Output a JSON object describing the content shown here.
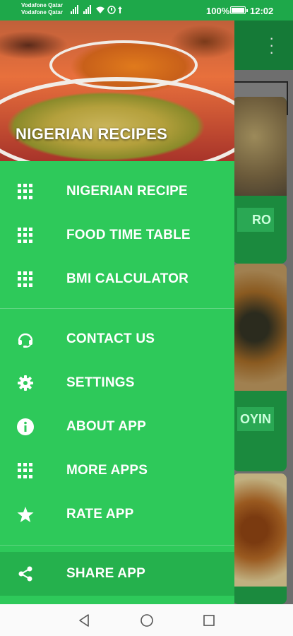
{
  "status_bar": {
    "carrier1": "Vodafone Qatar",
    "carrier2": "Vodafone Qatar",
    "battery": "100%",
    "time": "12:02"
  },
  "drawer": {
    "title": "NIGERIAN RECIPES",
    "primary_items": [
      {
        "label": "NIGERIAN RECIPE",
        "icon": "grid-icon"
      },
      {
        "label": "FOOD TIME TABLE",
        "icon": "grid-icon"
      },
      {
        "label": "BMI CALCULATOR",
        "icon": "grid-icon"
      }
    ],
    "secondary_items": [
      {
        "label": "CONTACT US",
        "icon": "headset-icon"
      },
      {
        "label": "SETTINGS",
        "icon": "gear-icon"
      },
      {
        "label": "ABOUT APP",
        "icon": "info-icon"
      },
      {
        "label": "MORE APPS",
        "icon": "grid-icon"
      },
      {
        "label": "RATE APP",
        "icon": "star-icon"
      }
    ],
    "share_item": {
      "label": "SHARE APP",
      "icon": "share-icon"
    }
  },
  "background": {
    "card1_label": "RO",
    "card2_label": "OYIN"
  },
  "colors": {
    "drawer_bg": "#2ec95a",
    "status_bar": "#1ea84a",
    "active_item": "#25b14d"
  }
}
